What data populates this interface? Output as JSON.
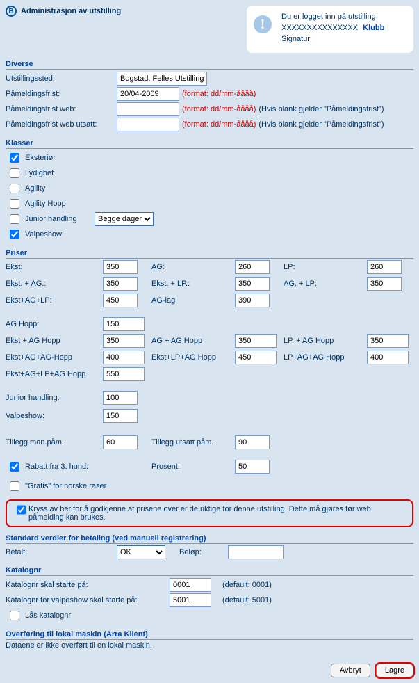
{
  "header": {
    "title": "Administrasjon av utstilling",
    "callout": {
      "line1": "Du er logget inn på utstilling:",
      "line2": "XXXXXXXXXXXXXXX",
      "klubb": "Klubb",
      "line3": "Signatur:"
    }
  },
  "diverse": {
    "section": "Diverse",
    "sted_label": "Utstillingssted:",
    "sted_value": "Bogstad, Felles Utstillinge",
    "frist_label": "Påmeldingsfrist:",
    "frist_value": "20/04-2009",
    "format_hint": "(format: dd/mm-åååå)",
    "fristweb_label": "Påmeldingsfrist web:",
    "fristweb_value": "",
    "fristweb_hint2": "(Hvis blank gjelder \"Påmeldingsfrist\")",
    "fristwebutsatt_label": "Påmeldingsfrist web utsatt:",
    "fristwebutsatt_value": "",
    "fristwebutsatt_hint2": "(Hvis blank gjelder \"Påmeldingsfrist\")"
  },
  "klasser": {
    "section": "Klasser",
    "items": {
      "eksterior": {
        "label": "Eksteriør",
        "checked": true
      },
      "lydighet": {
        "label": "Lydighet",
        "checked": false
      },
      "agility": {
        "label": "Agility",
        "checked": false
      },
      "agilityhopp": {
        "label": "Agility Hopp",
        "checked": false
      },
      "junior": {
        "label": "Junior handling",
        "checked": false
      },
      "valpeshow": {
        "label": "Valpeshow",
        "checked": true
      }
    },
    "junior_select": "Begge dager"
  },
  "priser": {
    "section": "Priser",
    "ekst": {
      "label": "Ekst:",
      "value": "350"
    },
    "ag": {
      "label": "AG:",
      "value": "260"
    },
    "lp": {
      "label": "LP:",
      "value": "260"
    },
    "ekst_ag": {
      "label": "Ekst. + AG.:",
      "value": "350"
    },
    "ekst_lp": {
      "label": "Ekst. + LP.:",
      "value": "350"
    },
    "ag_lp": {
      "label": "AG. + LP:",
      "value": "350"
    },
    "ekst_ag_lp": {
      "label": "Ekst+AG+LP:",
      "value": "450"
    },
    "ag_lag": {
      "label": "AG-lag",
      "value": "390"
    },
    "ag_hopp": {
      "label": "AG Hopp:",
      "value": "150"
    },
    "ekst_ag_hopp": {
      "label": "Ekst + AG Hopp",
      "value": "350"
    },
    "ag_ag_hopp": {
      "label": "AG + AG Hopp",
      "value": "350"
    },
    "lp_ag_hopp": {
      "label": "LP. + AG Hopp",
      "value": "350"
    },
    "ekst_ag_ag_hopp": {
      "label": "Ekst+AG+AG-Hopp",
      "value": "400"
    },
    "ekst_lp_ag_hopp": {
      "label": "Ekst+LP+AG Hopp",
      "value": "450"
    },
    "lp_ag_ag_hopp": {
      "label": "LP+AG+AG Hopp",
      "value": "400"
    },
    "ekst_ag_lp_ag_hopp": {
      "label": "Ekst+AG+LP+AG Hopp",
      "value": "550"
    },
    "junior": {
      "label": "Junior handling:",
      "value": "100"
    },
    "valpeshow": {
      "label": "Valpeshow:",
      "value": "150"
    },
    "tillegg_man": {
      "label": "Tillegg man.påm.",
      "value": "60"
    },
    "tillegg_utsatt": {
      "label": "Tillegg utsatt påm.",
      "value": "90"
    },
    "rabatt": {
      "label": "Rabatt fra 3. hund:",
      "checked": true
    },
    "prosent": {
      "label": "Prosent:",
      "value": "50"
    },
    "gratis": {
      "label": "\"Gratis\" for norske raser",
      "checked": false
    }
  },
  "approve": {
    "text": "Kryss av her for å godkjenne at prisene over er de riktige for denne utstilling. Dette må gjøres før web påmelding kan brukes.",
    "checked": true
  },
  "betaling": {
    "section": "Standard verdier for betaling (ved manuell registrering)",
    "betalt_label": "Betalt:",
    "betalt_value": "OK",
    "belop_label": "Beløp:",
    "belop_value": ""
  },
  "katalog": {
    "section": "Katalognr",
    "start_label": "Katalognr skal starte på:",
    "start_value": "0001",
    "start_hint": "(default: 0001)",
    "valpe_label": "Katalognr for valpeshow skal starte på:",
    "valpe_value": "5001",
    "valpe_hint": "(default: 5001)",
    "laas": {
      "label": "Lås katalognr",
      "checked": false
    }
  },
  "overforing": {
    "section": "Overføring til lokal maskin (Arra Klient)",
    "text": "Dataene er ikke overført til en lokal maskin."
  },
  "buttons": {
    "avbryt": "Avbryt",
    "lagre": "Lagre"
  }
}
